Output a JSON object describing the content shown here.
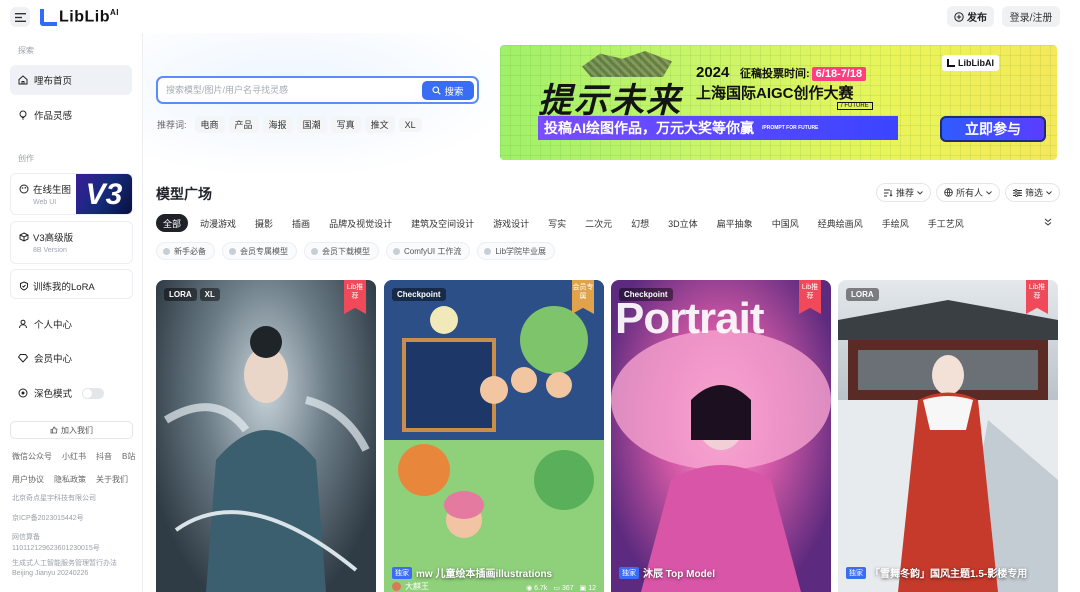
{
  "brand": {
    "name": "LibLib",
    "suffix": "AI"
  },
  "header": {
    "publish_label": "发布",
    "login_label": "登录/注册"
  },
  "sidebar": {
    "section_explore": "探索",
    "section_create": "创作",
    "items": [
      {
        "label": "哩布首页"
      },
      {
        "label": "作品灵感"
      }
    ],
    "online_gen": {
      "label": "在线生图",
      "sub": "Web UI",
      "badge": "V3"
    },
    "v3_client": {
      "label": "V3高级版",
      "sub": "8B Version"
    },
    "train_lora": "训练我的LoRA",
    "personal": "个人中心",
    "member": "会员中心",
    "dark_mode": "深色模式",
    "join_us": "加入我们",
    "links_row1": [
      "微信公众号",
      "小红书",
      "抖音",
      "B站"
    ],
    "links_row2": [
      "用户协议",
      "隐私政策",
      "关于我们"
    ],
    "footer_lines": [
      "北京奇点星宇科技有限公司",
      "京ICP备2023015442号",
      "网信算备",
      "110112129623601230015号",
      "生成式人工智能服务管理暂行办法",
      "Beijing Jianyu 20240226"
    ]
  },
  "search": {
    "placeholder": "搜索模型/图片/用户名寻找灵感",
    "button_label": "搜索",
    "hot_label": "推荐词:",
    "hot_tags": [
      "电商",
      "产品",
      "海报",
      "国潮",
      "写真",
      "推文",
      "XL"
    ]
  },
  "banner": {
    "big_text": "提示未来",
    "year": "2024",
    "date_label": "征稿投票时间:",
    "date_range": "6/18-7/18",
    "title": "上海国际AIGC创作大赛",
    "future_tag": "/ FUTURE",
    "bar_text": "投稿AI绘图作品，万元大奖等你赢",
    "bar_small": "/PROMPT FOR FUTURE",
    "cta": "立即参与",
    "logo_text": "LibLibAI"
  },
  "models": {
    "title": "模型广场",
    "sort_recommend": "推荐",
    "sort_owner": "所有人",
    "sort_filter": "筛选",
    "categories": [
      "全部",
      "动漫游戏",
      "摄影",
      "插画",
      "品牌及视觉设计",
      "建筑及空间设计",
      "游戏设计",
      "写实",
      "二次元",
      "幻想",
      "3D立体",
      "扁平抽象",
      "中国风",
      "经典绘画风",
      "手绘风",
      "手工艺风"
    ],
    "sub_tags": [
      "新手必备",
      "会员专属模型",
      "会员下载模型",
      "ComfyUI 工作流",
      "Lib学院毕业展"
    ]
  },
  "cards": [
    {
      "type1": "LORA",
      "type2": "XL",
      "ribbon": "Lib推荐",
      "name": "",
      "author": "",
      "stats": []
    },
    {
      "type1": "Checkpoint",
      "type2": "",
      "ribbon": "会员专属",
      "exclusive": "独家",
      "name": "mw 儿童绘本插画illustrations",
      "author": "大麒王",
      "stats": [
        "6.7k",
        "367",
        "12"
      ]
    },
    {
      "type1": "Checkpoint",
      "type2": "",
      "ribbon": "Lib推荐",
      "exclusive": "独家",
      "name": "沐辰 Top Model",
      "portrait": "Portrait",
      "author": "",
      "stats": []
    },
    {
      "type1": "LORA",
      "type2": "",
      "ribbon": "Lib推荐",
      "exclusive": "独家",
      "name": "「雪舞冬韵」国风主题1.5-影楼专用",
      "author": "",
      "stats": []
    }
  ]
}
